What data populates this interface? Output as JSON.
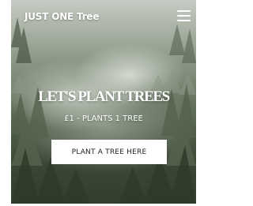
{
  "header": {
    "brand": "JUST ONE Tree",
    "menu_icon": "hamburger-menu-icon"
  },
  "hero": {
    "headline": "LET'S PLANT TREES",
    "subline": "£1 - PLANTS 1 TREE",
    "cta_label": "PLANT A TREE HERE",
    "background": "misty-forest-photo"
  },
  "colors": {
    "text": "#ffffff",
    "button_bg": "#ffffff",
    "button_text": "#222222"
  }
}
